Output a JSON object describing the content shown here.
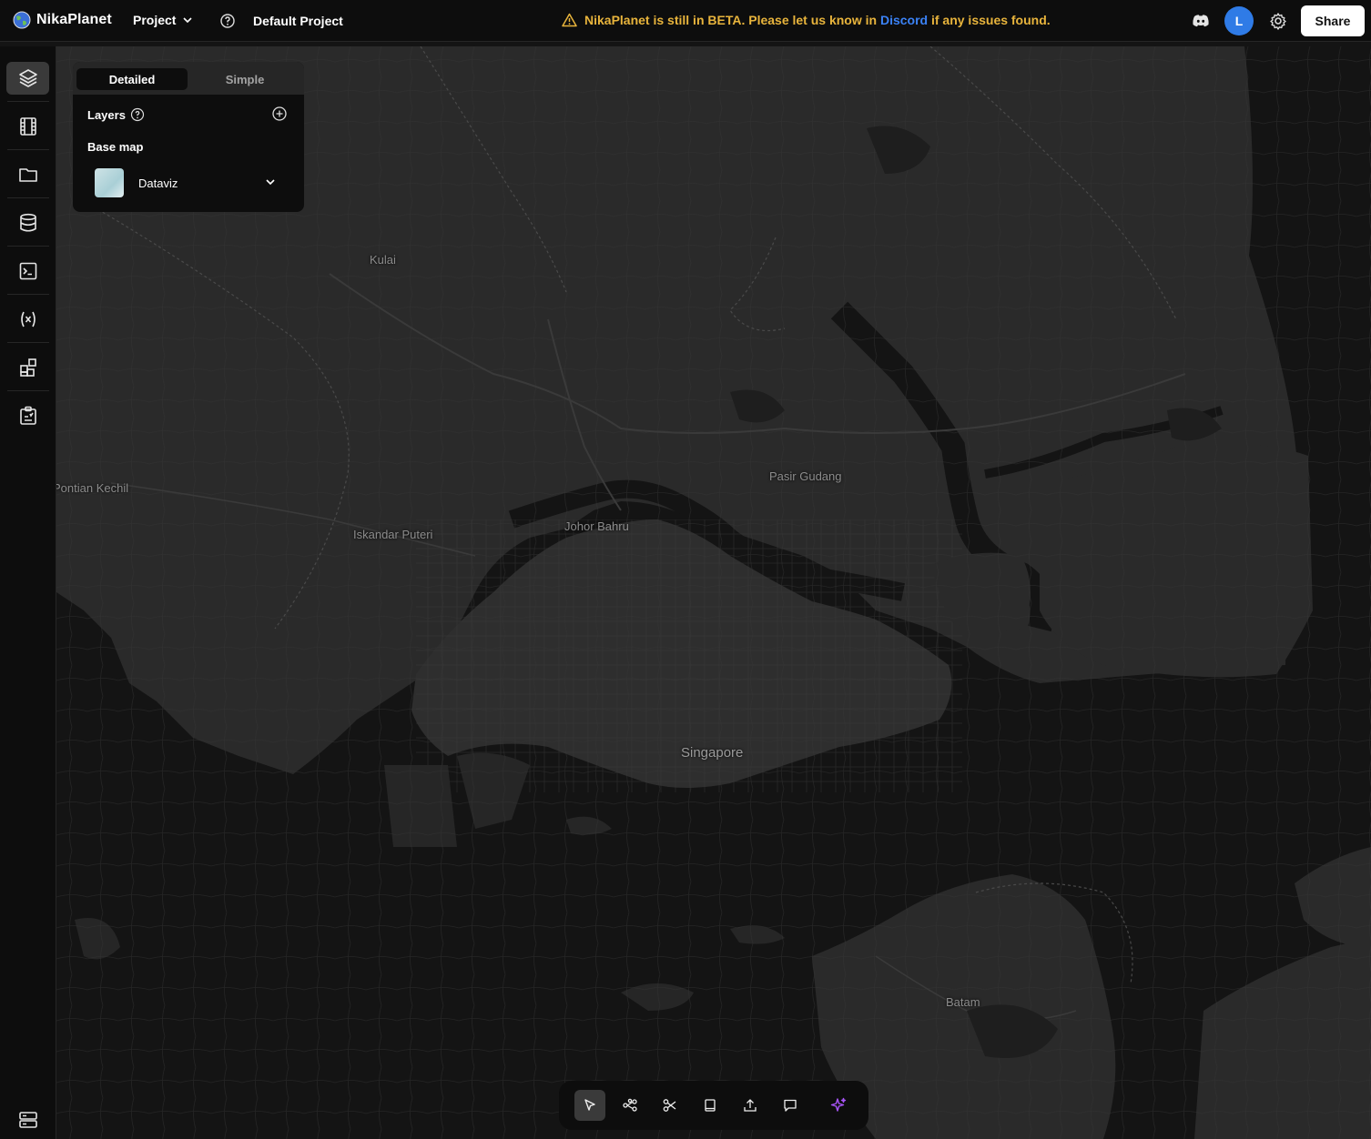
{
  "header": {
    "brand": "NikaPlanet",
    "project_menu": "Project",
    "project_name": "Default Project",
    "beta_before": "NikaPlanet is still in BETA. Please let us know in",
    "beta_link": "Discord",
    "beta_after": "if any issues found.",
    "avatar_initial": "L",
    "share_label": "Share"
  },
  "sidebar": {
    "items": [
      {
        "icon": "layers-icon",
        "active": true
      },
      {
        "icon": "film-icon"
      },
      {
        "icon": "folder-icon"
      },
      {
        "icon": "database-icon"
      },
      {
        "icon": "terminal-icon"
      },
      {
        "icon": "variable-icon"
      },
      {
        "icon": "widgets-icon"
      },
      {
        "icon": "clipboard-icon"
      },
      {
        "icon": "server-icon"
      }
    ]
  },
  "panel": {
    "tabs": [
      "Detailed",
      "Simple"
    ],
    "active_tab": "Detailed",
    "layers_label": "Layers",
    "basemap_label": "Base map",
    "basemap_value": "Dataviz"
  },
  "map": {
    "labels": {
      "kulai": "Kulai",
      "pontian": "Pontian Kechil",
      "iskandar": "Iskandar Puteri",
      "johor": "Johor Bahru",
      "pasir": "Pasir Gudang",
      "singapore": "Singapore",
      "batam": "Batam"
    }
  },
  "toolbar": {
    "tools": [
      "select-icon",
      "nodes-icon",
      "scissors-icon",
      "book-icon",
      "upload-icon",
      "comment-icon",
      "sparkle-icon"
    ],
    "active_tool": "select-icon"
  },
  "colors": {
    "accent": "#3b82f6",
    "beta_warning": "#e8b43c",
    "avatar": "#2f7be6",
    "sparkle": "#a855f7",
    "land": "#2a2a2a",
    "water": "#141414"
  }
}
